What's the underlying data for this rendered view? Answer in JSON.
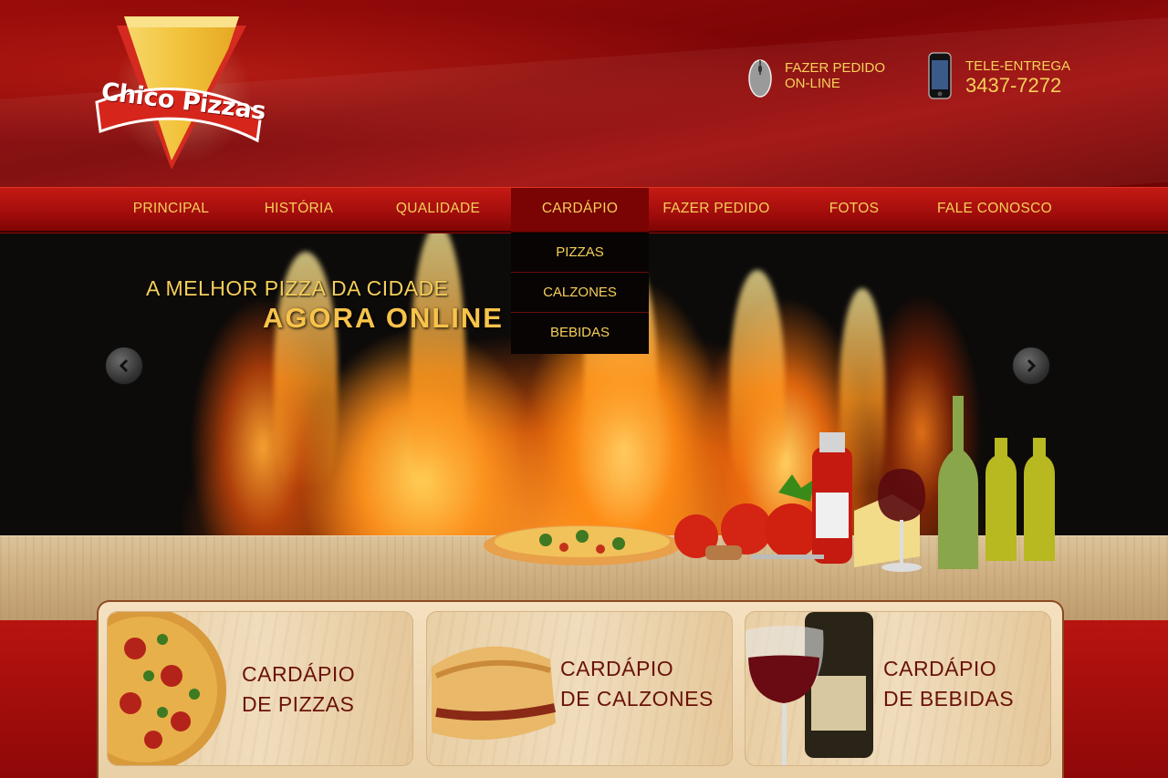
{
  "brand": {
    "name": "Chico Pizzas"
  },
  "header": {
    "online_order": {
      "line1": "FAZER PEDIDO",
      "line2": "ON-LINE"
    },
    "delivery": {
      "label": "TELE-ENTREGA",
      "phone": "3437-7272"
    }
  },
  "nav": {
    "items": [
      {
        "label": "PRINCIPAL"
      },
      {
        "label": "HISTÓRIA"
      },
      {
        "label": "QUALIDADE"
      },
      {
        "label": "CARDÁPIO"
      },
      {
        "label": "FAZER PEDIDO"
      },
      {
        "label": "FOTOS"
      },
      {
        "label": "FALE CONOSCO"
      }
    ],
    "active": "CARDÁPIO",
    "dropdown": [
      "PIZZAS",
      "CALZONES",
      "BEBIDAS"
    ]
  },
  "hero": {
    "line1": "A MELHOR PIZZA DA CIDADE",
    "line2": "AGORA ONLINE"
  },
  "cards": [
    {
      "line1": "CARDÁPIO",
      "line2": "DE PIZZAS"
    },
    {
      "line1": "CARDÁPIO",
      "line2": "DE CALZONES"
    },
    {
      "line1": "CARDÁPIO",
      "line2": "DE BEBIDAS"
    }
  ],
  "colors": {
    "header_red": "#8c0707",
    "nav_red": "#a10d0b",
    "accent_gold": "#f6cf5a",
    "card_text": "#6a1208"
  },
  "icons": [
    "mouse-icon",
    "phone-icon",
    "chevron-left-icon",
    "chevron-right-icon"
  ]
}
